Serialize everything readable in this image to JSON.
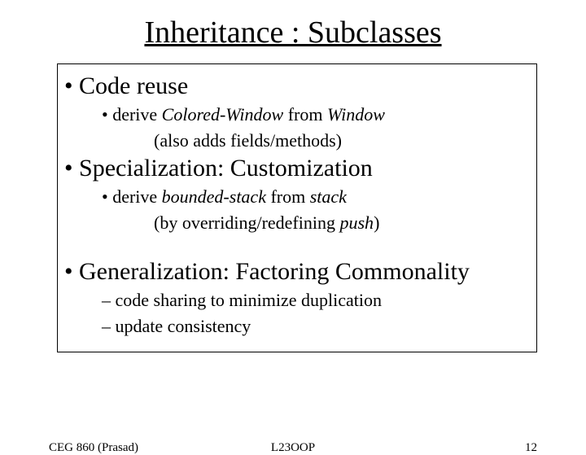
{
  "title": "Inheritance : Subclasses",
  "b1": "Code reuse",
  "b1s_pre": "derive ",
  "b1s_it1": "Colored-Window",
  "b1s_mid": " from ",
  "b1s_it2": "Window",
  "b1s2": "(also adds fields/methods)",
  "b2": "Specialization: Customization",
  "b2s_pre": "derive ",
  "b2s_it1": "bounded-stack",
  "b2s_mid": " from ",
  "b2s_it2": "stack",
  "b2s2_pre": "(by overriding/redefining ",
  "b2s2_it": "push",
  "b2s2_post": ")",
  "b3": "Generalization: Factoring Commonality",
  "b3d1": "code sharing to minimize duplication",
  "b3d2": "update consistency",
  "footer_left": "CEG 860  (Prasad)",
  "footer_mid": "L23OOP",
  "footer_right": "12"
}
